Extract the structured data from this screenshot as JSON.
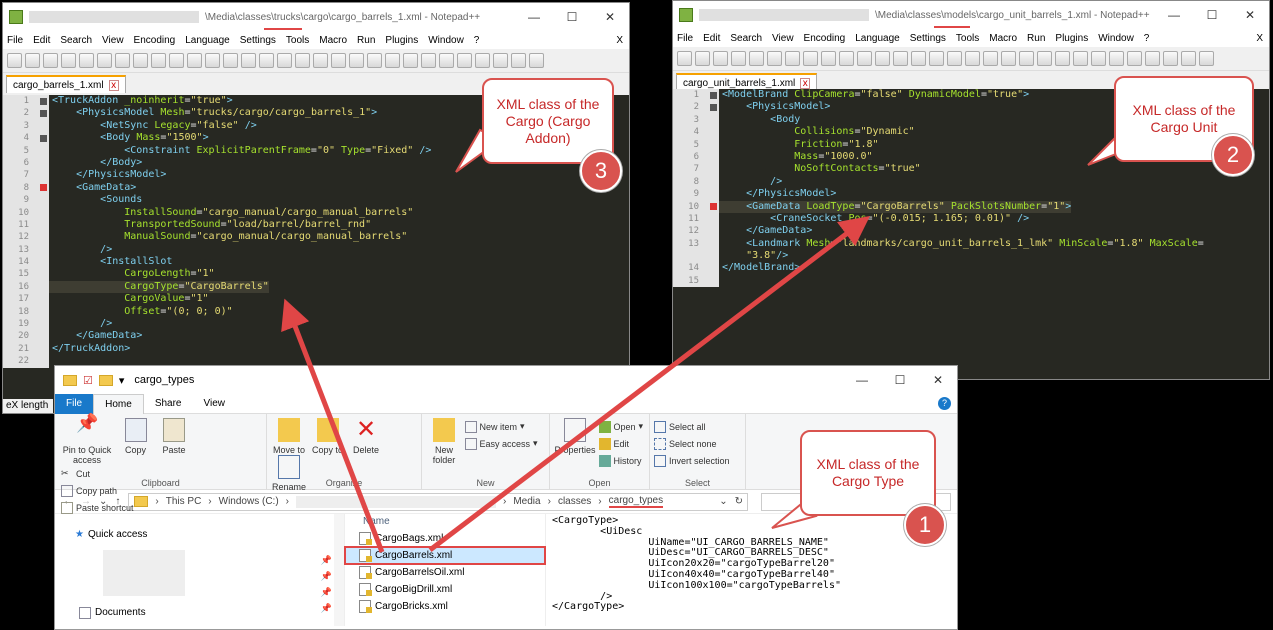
{
  "npp1": {
    "title": "\\Media\\classes\\trucks\\cargo\\cargo_barrels_1.xml - Notepad++",
    "tab": "cargo_barrels_1.xml",
    "status": "eX length",
    "code": [
      [
        "1",
        "<TruckAddon _noinherit=\"true\">"
      ],
      [
        "2",
        "    <PhysicsModel Mesh=\"trucks/cargo/cargo_barrels_1\">"
      ],
      [
        "3",
        "        <NetSync Legacy=\"false\" />"
      ],
      [
        "4",
        "        <Body Mass=\"1500\">"
      ],
      [
        "5",
        "            <Constraint ExplicitParentFrame=\"0\" Type=\"Fixed\" />"
      ],
      [
        "6",
        "        </Body>"
      ],
      [
        "7",
        "    </PhysicsModel>"
      ],
      [
        "8",
        "    <GameData>"
      ],
      [
        "9",
        "        <Sounds"
      ],
      [
        "10",
        "            InstallSound=\"cargo_manual/cargo_manual_barrels\""
      ],
      [
        "11",
        "            TransportedSound=\"load/barrel/barrel_rnd\""
      ],
      [
        "12",
        "            ManualSound=\"cargo_manual/cargo_manual_barrels\""
      ],
      [
        "13",
        "        />"
      ],
      [
        "14",
        "        <InstallSlot"
      ],
      [
        "15",
        "            CargoLength=\"1\""
      ],
      [
        "16",
        "            CargoType=\"CargoBarrels\""
      ],
      [
        "17",
        "            CargoValue=\"1\""
      ],
      [
        "18",
        "            Offset=\"(0; 0; 0)\""
      ],
      [
        "19",
        "        />"
      ],
      [
        "20",
        "    </GameData>"
      ],
      [
        "21",
        "</TruckAddon>"
      ],
      [
        "22",
        ""
      ]
    ]
  },
  "npp2": {
    "title": "\\Media\\classes\\models\\cargo_unit_barrels_1.xml - Notepad++",
    "tab": "cargo_unit_barrels_1.xml",
    "code": [
      [
        "1",
        "<ModelBrand ClipCamera=\"false\" DynamicModel=\"true\">"
      ],
      [
        "2",
        "    <PhysicsModel>"
      ],
      [
        "3",
        "        <Body"
      ],
      [
        "4",
        "            Collisions=\"Dynamic\""
      ],
      [
        "5",
        "            Friction=\"1.8\""
      ],
      [
        "6",
        "            Mass=\"1000.0\""
      ],
      [
        "7",
        "            NoSoftContacts=\"true\""
      ],
      [
        "8",
        "        />"
      ],
      [
        "9",
        "    </PhysicsModel>"
      ],
      [
        "10",
        "    <GameData LoadType=\"CargoBarrels\" PackSlotsNumber=\"1\">"
      ],
      [
        "11",
        "        <CraneSocket Pos=\"(-0.015; 1.165; 0.01)\" />"
      ],
      [
        "12",
        "    </GameData>"
      ],
      [
        "13",
        "    <Landmark Mesh=\"landmarks/cargo_unit_barrels_1_lmk\" MinScale=\"1.8\" MaxScale="
      ],
      [
        "",
        "    \"3.8\"/>"
      ],
      [
        "14",
        "</ModelBrand>"
      ],
      [
        "15",
        ""
      ]
    ]
  },
  "menu": [
    "File",
    "Edit",
    "Search",
    "View",
    "Encoding",
    "Language",
    "Settings",
    "Tools",
    "Macro",
    "Run",
    "Plugins",
    "Window",
    "?"
  ],
  "menu_close": "X",
  "explorer": {
    "title": "cargo_types",
    "ribbon_tabs": {
      "file": "File",
      "home": "Home",
      "share": "Share",
      "view": "View"
    },
    "clipboard": {
      "pin": "Pin to Quick access",
      "copy": "Copy",
      "paste": "Paste",
      "cut": "Cut",
      "copy_path": "Copy path",
      "paste_shortcut": "Paste shortcut",
      "label": "Clipboard"
    },
    "organize": {
      "move": "Move to",
      "copy": "Copy to",
      "delete": "Delete",
      "rename": "Rename",
      "label": "Organize"
    },
    "new": {
      "new_folder": "New folder",
      "new_item": "New item",
      "easy_access": "Easy access",
      "label": "New"
    },
    "open": {
      "properties": "Properties",
      "open": "Open",
      "edit": "Edit",
      "history": "History",
      "label": "Open"
    },
    "select": {
      "all": "Select all",
      "none": "Select none",
      "invert": "Invert selection",
      "label": "Select"
    },
    "address": [
      "This PC",
      "Windows (C:)",
      "Media",
      "classes",
      "cargo_types"
    ],
    "nav": {
      "quick_access": "Quick access",
      "documents": "Documents"
    },
    "col_name": "Name",
    "files": [
      "CargoBags.xml",
      "CargoBarrels.xml",
      "CargoBarrelsOil.xml",
      "CargoBigDrill.xml",
      "CargoBricks.xml"
    ],
    "preview": "<CargoType>\n\t<UiDesc\n\t\tUiName=\"UI_CARGO_BARRELS_NAME\"\n\t\tUiDesc=\"UI_CARGO_BARRELS_DESC\"\n\t\tUiIcon20x20=\"cargoTypeBarrel20\"\n\t\tUiIcon40x40=\"cargoTypeBarrel40\"\n\t\tUiIcon100x100=\"cargoTypeBarrels\"\n\t/>\n</CargoType>"
  },
  "callouts": {
    "c3": "XML class of the Cargo (Cargo Addon)",
    "c2": "XML class of the Cargo Unit",
    "c1": "XML class of the Cargo Type",
    "b1": "1",
    "b2": "2",
    "b3": "3"
  }
}
